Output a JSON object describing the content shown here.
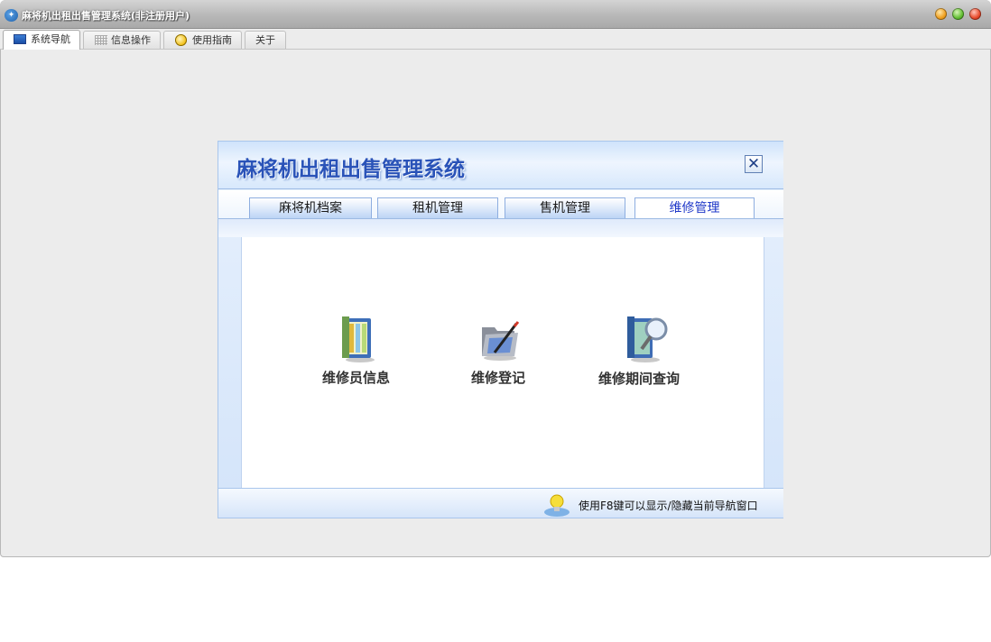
{
  "window": {
    "title": "麻将机出租出售管理系统(非注册用户)"
  },
  "tabs": [
    {
      "label": "系统导航",
      "icon": "monitor-icon",
      "active": true
    },
    {
      "label": "信息操作",
      "icon": "grid-icon",
      "active": false
    },
    {
      "label": "使用指南",
      "icon": "guide-icon",
      "active": false
    },
    {
      "label": "关于",
      "icon": "",
      "active": false
    }
  ],
  "panel": {
    "title": "麻将机出租出售管理系统",
    "close_label": "✕",
    "tabs": [
      {
        "label": "麻将机档案",
        "active": false
      },
      {
        "label": "租机管理",
        "active": false
      },
      {
        "label": "售机管理",
        "active": false
      },
      {
        "label": "维修管理",
        "active": true
      }
    ],
    "items": [
      {
        "label": "维修员信息",
        "icon": "binder-icon"
      },
      {
        "label": "维修登记",
        "icon": "folder-pen-icon"
      },
      {
        "label": "维修期间查询",
        "icon": "book-search-icon"
      }
    ],
    "hint": "使用F8键可以显示/隐藏当前导航窗口"
  },
  "colors": {
    "accent": "#2a53b8",
    "active_tab_text": "#1f38c8",
    "panel_bg": "#e9f2fd"
  }
}
